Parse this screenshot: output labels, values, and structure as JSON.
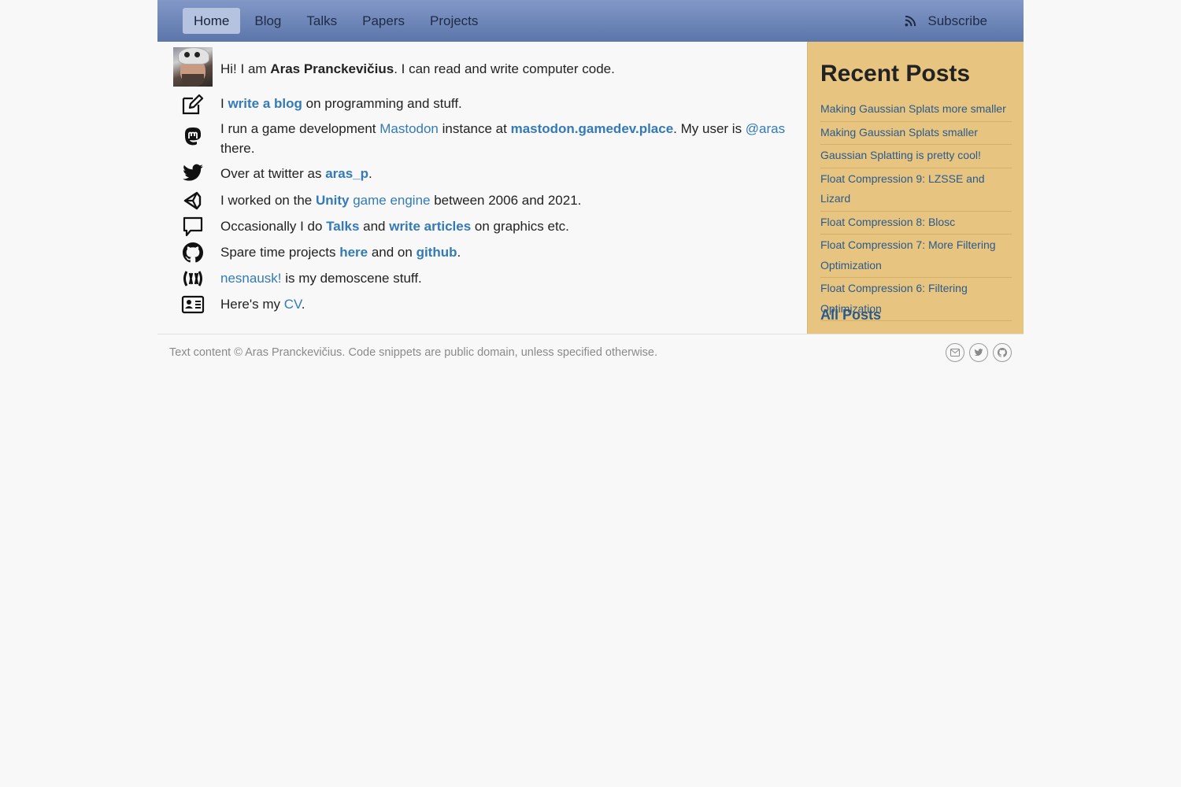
{
  "nav": {
    "items": [
      {
        "label": "Home",
        "active": true
      },
      {
        "label": "Blog"
      },
      {
        "label": "Talks"
      },
      {
        "label": "Papers"
      },
      {
        "label": "Projects"
      }
    ],
    "subscribe_label": "Subscribe",
    "subscribe_icon": "rss-icon"
  },
  "intro": {
    "pre": "Hi! I am ",
    "name": "Aras Pranckevičius",
    "post": ". I can read and write computer code."
  },
  "lines": {
    "blog": {
      "pre": "I ",
      "link": "write a blog",
      "post": " on programming and stuff."
    },
    "mastodon": {
      "pre": "I run a game development ",
      "link1": "Mastodon",
      "mid1": " instance at ",
      "link2": "mastodon.gamedev.place",
      "mid2": ". My user is ",
      "link3": "@aras",
      "post": " there."
    },
    "twitter": {
      "pre": "Over at twitter as ",
      "link": "aras_p",
      "post": "."
    },
    "unity": {
      "pre": "I worked on the ",
      "link1": "Unity",
      "link2": " game engine",
      "post": " between 2006 and 2021."
    },
    "talks": {
      "pre": "Occasionally I do ",
      "link1": "Talks",
      "mid": " and ",
      "link2": "write articles",
      "post": " on graphics etc."
    },
    "github": {
      "pre": "Spare time projects ",
      "link1": "here",
      "mid": " and on ",
      "link2": "github",
      "post": "."
    },
    "demoscene": {
      "link": "nesnausk!",
      "post": " is my demoscene stuff."
    },
    "cv": {
      "pre": "Here's my ",
      "link": "CV",
      "post": "."
    }
  },
  "sidebar": {
    "title": "Recent Posts",
    "posts": [
      "Making Gaussian Splats more smaller",
      "Making Gaussian Splats smaller",
      "Gaussian Splatting is pretty cool!",
      "Float Compression 9: LZSSE and Lizard",
      "Float Compression 8: Blosc",
      "Float Compression 7: More Filtering Optimization",
      "Float Compression 6: Filtering Optimization"
    ],
    "all_posts": "All Posts"
  },
  "footer": {
    "text": "Text content © Aras Pranckevičius. Code snippets are public domain, unless specified otherwise.",
    "icons": [
      "email-icon",
      "twitter-icon",
      "github-icon"
    ]
  },
  "colors": {
    "nav_top": "#8298c7",
    "nav_bottom": "#5c76aa",
    "link": "#337ab7",
    "sidebar_bg": "#e7c581",
    "page_bg": "#f8f8f8"
  }
}
